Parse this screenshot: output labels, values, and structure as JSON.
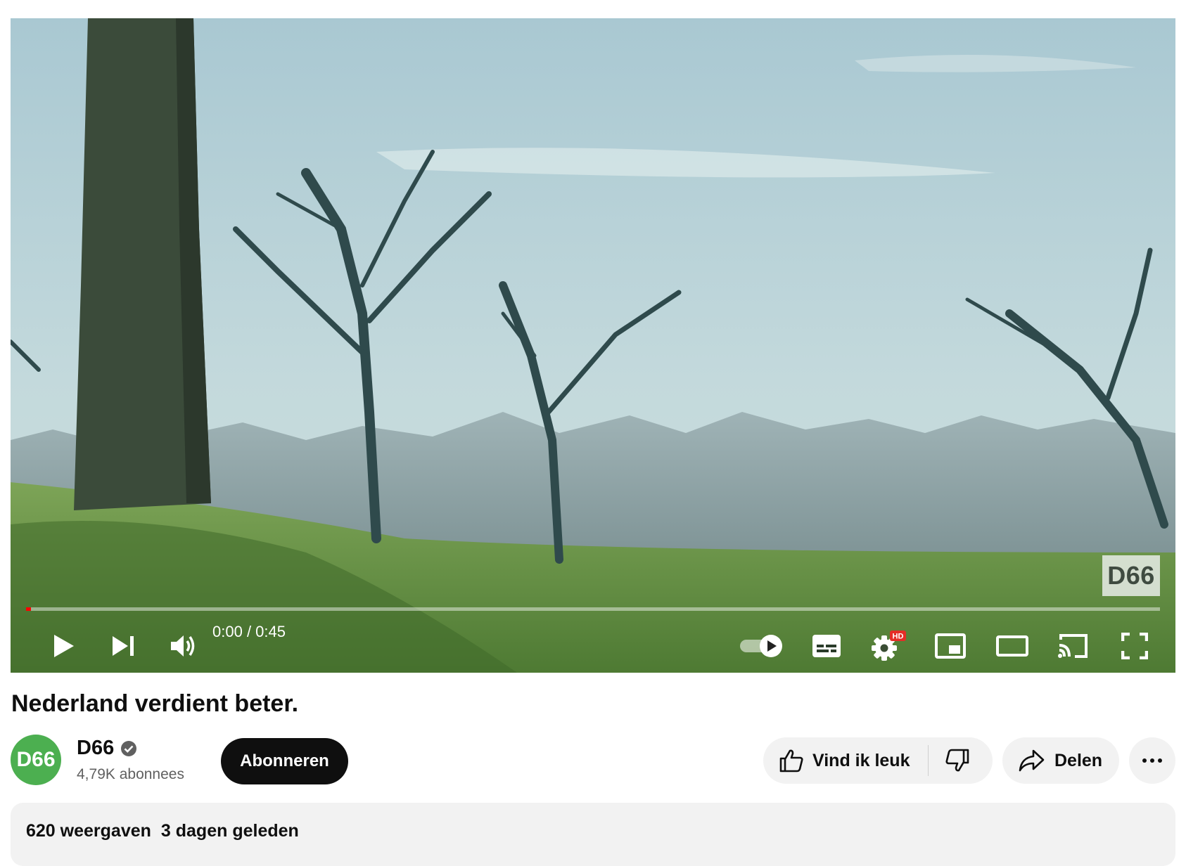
{
  "player": {
    "watermark": "D66",
    "time_current": "0:00",
    "time_separator": " / ",
    "time_total": "0:45",
    "progress_fraction": 0.0,
    "icons": {
      "play": "play-icon",
      "next": "next-icon",
      "volume": "volume-icon",
      "autoplay": "autoplay-toggle-icon",
      "subtitles": "subtitles-icon",
      "settings": "settings-gear-icon",
      "settings_badge": "HD",
      "miniplayer": "miniplayer-icon",
      "theater": "theater-mode-icon",
      "cast": "cast-icon",
      "fullscreen": "fullscreen-icon"
    }
  },
  "video": {
    "title": "Nederland verdient beter."
  },
  "channel": {
    "avatar_text": "D66",
    "name": "D66",
    "verified": true,
    "subscribers": "4,79K abonnees",
    "subscribe_label": "Abonneren"
  },
  "actions": {
    "like_label": "Vind ik leuk",
    "share_label": "Delen"
  },
  "description": {
    "views": "620 weergaven",
    "date": "3 dagen geleden"
  },
  "colors": {
    "progress_played": "#ff0000",
    "avatar_bg": "#4caf50",
    "subscribe_bg": "#0f0f0f",
    "pill_bg": "#f2f2f2"
  }
}
